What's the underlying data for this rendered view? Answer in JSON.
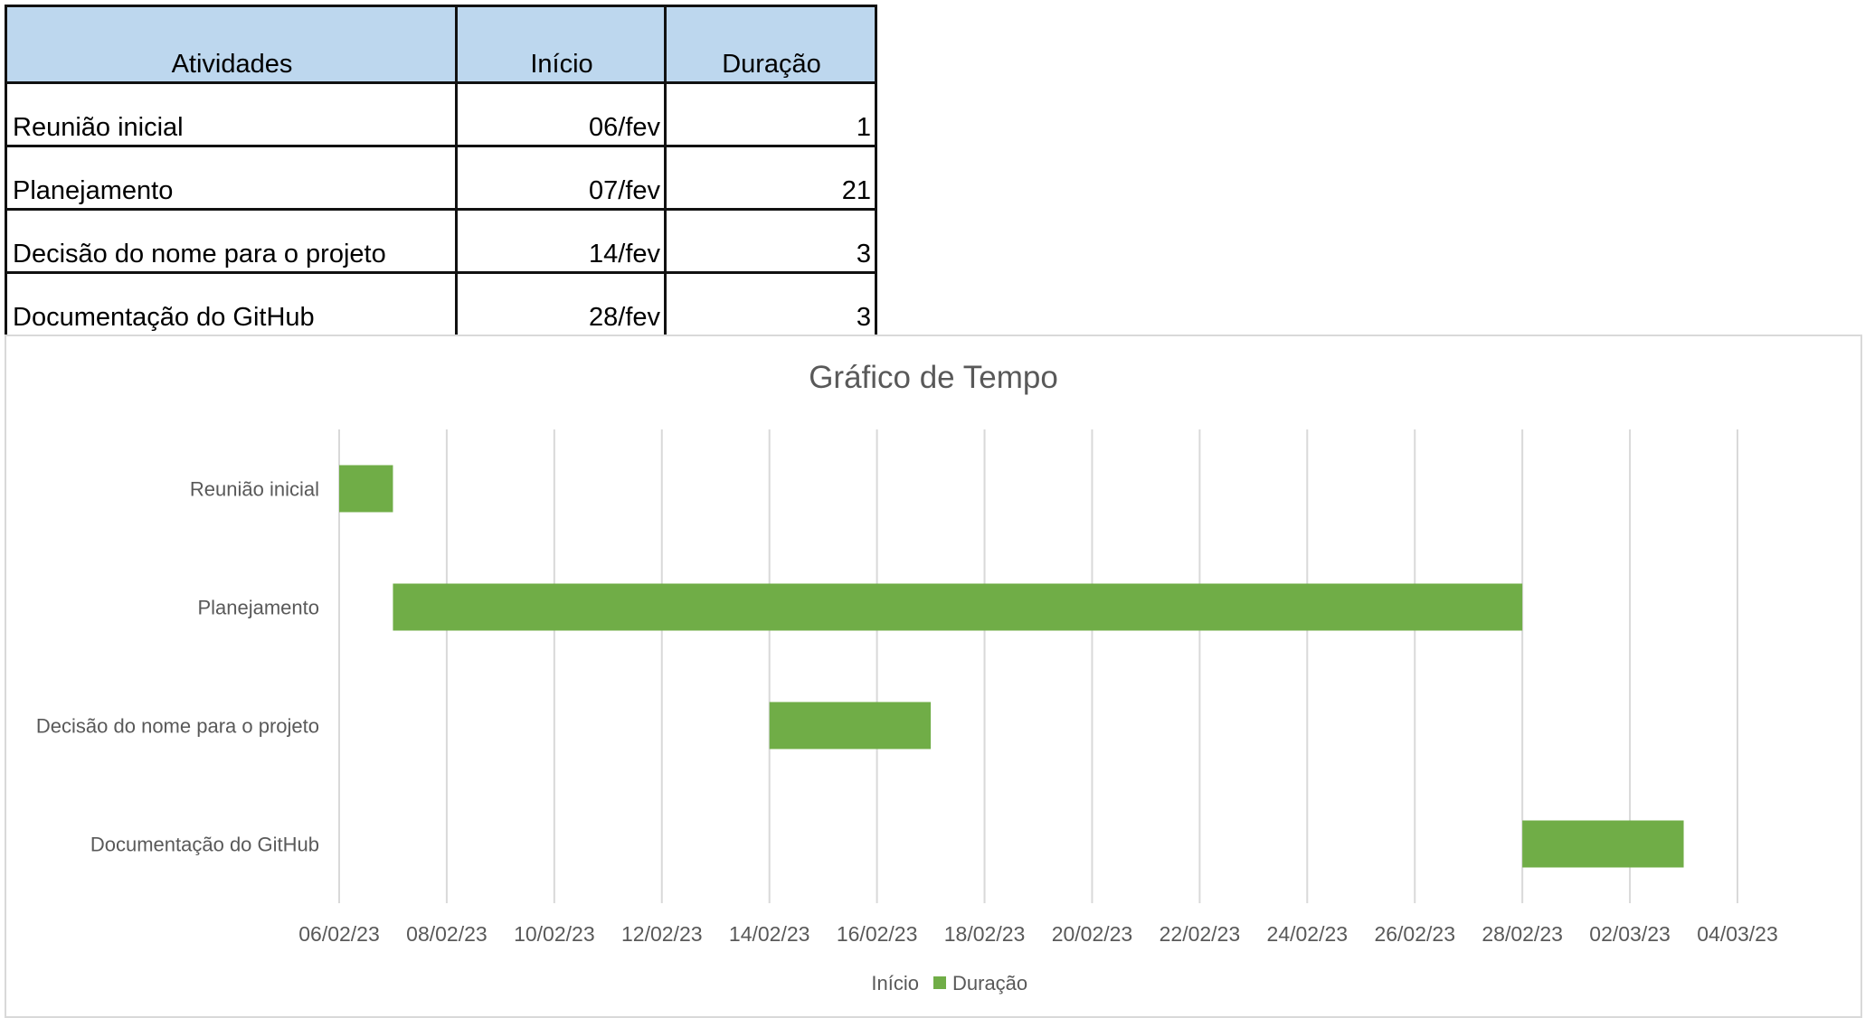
{
  "table": {
    "headers": [
      "Atividades",
      "Início",
      "Duração"
    ],
    "rows": [
      {
        "atividade": "Reunião inicial",
        "inicio": "06/fev",
        "duracao": "1"
      },
      {
        "atividade": "Planejamento",
        "inicio": "07/fev",
        "duracao": "21"
      },
      {
        "atividade": "Decisão do nome para o projeto",
        "inicio": "14/fev",
        "duracao": "3"
      },
      {
        "atividade": "Documentação do GitHub",
        "inicio": "28/fev",
        "duracao": "3"
      }
    ],
    "header_color": "#bdd7ee"
  },
  "chart_data": {
    "type": "bar",
    "orientation": "horizontal-stacked",
    "title": "Gráfico de Tempo",
    "categories": [
      "Reunião inicial",
      "Planejamento",
      "Decisão do nome para o projeto",
      "Documentação do GitHub"
    ],
    "series": [
      {
        "name": "Início",
        "values": [
          "2023-02-06",
          "2023-02-07",
          "2023-02-14",
          "2023-02-28"
        ],
        "color": "none"
      },
      {
        "name": "Duração",
        "values": [
          1,
          21,
          3,
          3
        ],
        "color": "#70ad47"
      }
    ],
    "xlim": [
      "2023-02-06",
      "2023-03-04"
    ],
    "x_tick_labels": [
      "06/02/23",
      "08/02/23",
      "10/02/23",
      "12/02/23",
      "14/02/23",
      "16/02/23",
      "18/02/23",
      "20/02/23",
      "22/02/23",
      "24/02/23",
      "26/02/23",
      "28/02/23",
      "02/03/23",
      "04/03/23"
    ],
    "grid": true,
    "grid_color": "#d9d9d9",
    "legend_position": "bottom",
    "text_color": "#595959"
  }
}
